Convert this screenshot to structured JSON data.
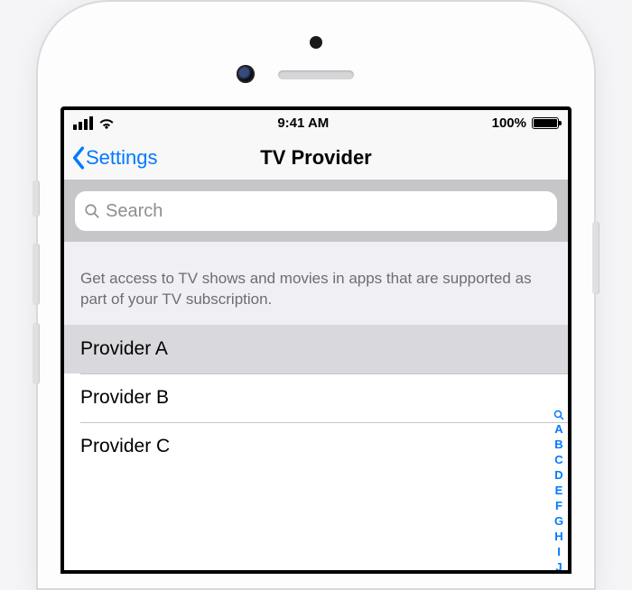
{
  "statusbar": {
    "time": "9:41 AM",
    "battery_pct": "100%"
  },
  "nav": {
    "back_label": "Settings",
    "title": "TV Provider"
  },
  "search": {
    "placeholder": "Search"
  },
  "description": "Get access to TV shows and movies in apps that are supported as part of your TV subscription.",
  "providers": [
    {
      "label": "Provider A",
      "selected": true
    },
    {
      "label": "Provider B",
      "selected": false
    },
    {
      "label": "Provider C",
      "selected": false
    }
  ],
  "index_letters": [
    "A",
    "B",
    "C",
    "D",
    "E",
    "F",
    "G",
    "H",
    "I",
    "J"
  ]
}
